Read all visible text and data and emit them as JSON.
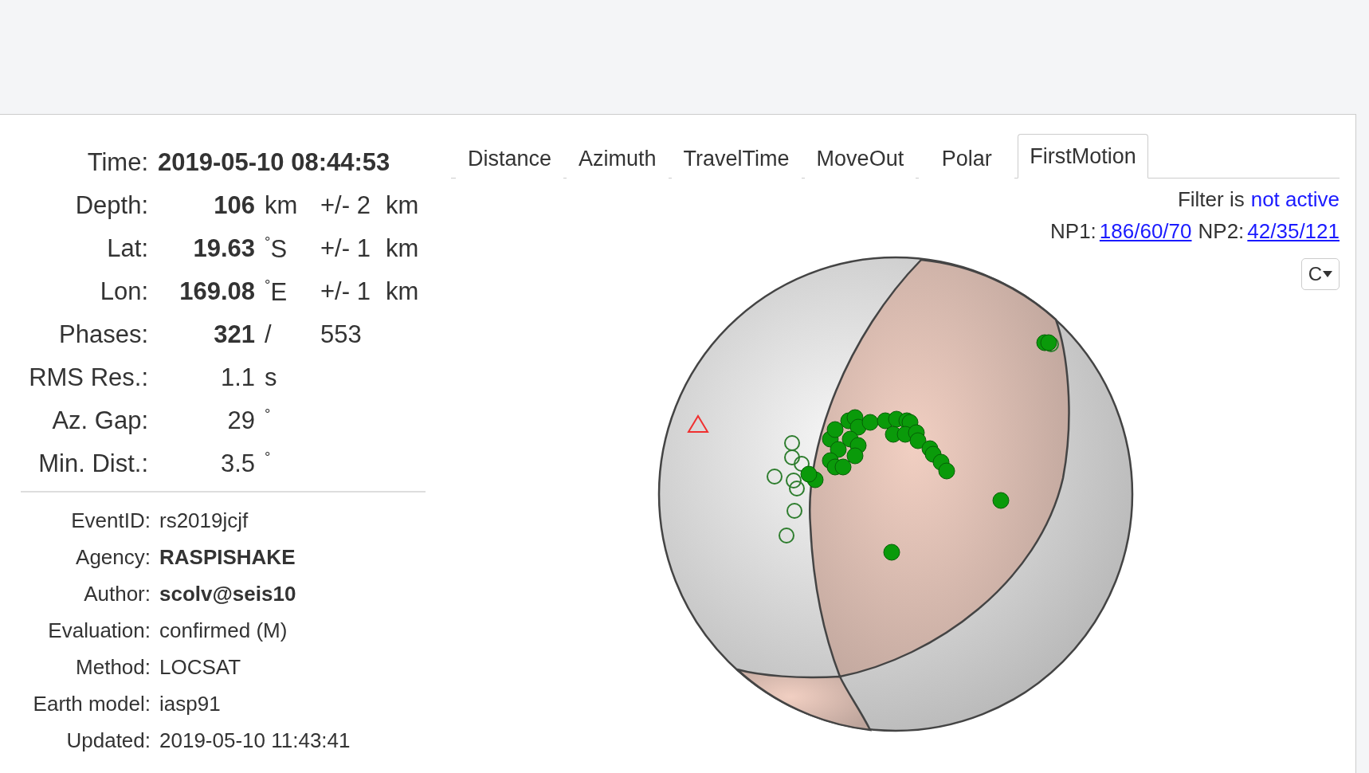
{
  "summary": [
    {
      "label": "Time:",
      "kind": "wide",
      "cells": [
        {
          "text": "2019-05-10 08:44:53",
          "bold": true
        }
      ]
    },
    {
      "label": "Depth:",
      "kind": "grid",
      "cells": [
        {
          "text": "106",
          "bold": true
        },
        {
          "text": "km",
          "bold": false
        },
        {
          "text": "+/- 2",
          "bold": false
        },
        {
          "text": "km",
          "bold": false
        }
      ]
    },
    {
      "label": "Lat:",
      "kind": "grid",
      "cells": [
        {
          "text": "19.63",
          "bold": true
        },
        {
          "text": "$^{°}$S",
          "bold": false
        },
        {
          "text": "+/- 1",
          "bold": false
        },
        {
          "text": "km",
          "bold": false
        }
      ]
    },
    {
      "label": "Lon:",
      "kind": "grid",
      "cells": [
        {
          "text": "169.08",
          "bold": true
        },
        {
          "text": "$^{°}$E",
          "bold": false
        },
        {
          "text": "+/- 1",
          "bold": false
        },
        {
          "text": "km",
          "bold": false
        }
      ]
    },
    {
      "label": "Phases:",
      "kind": "grid",
      "cells": [
        {
          "text": "321",
          "bold": true
        },
        {
          "text": "/",
          "bold": false
        },
        {
          "text": "553",
          "bold": false
        }
      ]
    },
    {
      "label": "RMS Res.:",
      "kind": "grid",
      "cells": [
        {
          "text": "1.1",
          "bold": false
        },
        {
          "text": "s",
          "bold": false
        }
      ]
    },
    {
      "label": "Az. Gap:",
      "kind": "grid",
      "cells": [
        {
          "text": "29",
          "bold": false
        },
        {
          "text": "$^{°}$",
          "bold": false
        }
      ]
    },
    {
      "label": "Min. Dist.:",
      "kind": "grid",
      "cells": [
        {
          "text": "3.5",
          "bold": false
        },
        {
          "text": "$^{°}$",
          "bold": false
        }
      ]
    }
  ],
  "details": [
    {
      "label": "EventID:",
      "value": "rs2019jcjf",
      "bold": false
    },
    {
      "label": "Agency:",
      "value": "RASPISHAKE",
      "bold": true
    },
    {
      "label": "Author:",
      "value": "scolv@seis10",
      "bold": true
    },
    {
      "label": "Evaluation:",
      "value": "confirmed (M)",
      "bold": false
    },
    {
      "label": "Method:",
      "value": "LOCSAT",
      "bold": false
    },
    {
      "label": "Earth model:",
      "value": "iasp91",
      "bold": false
    },
    {
      "label": "Updated:",
      "value": "2019-05-10 11:43:41",
      "bold": false
    }
  ],
  "tabs": [
    {
      "label": "Distance",
      "selected": false
    },
    {
      "label": "Azimuth",
      "selected": false
    },
    {
      "label": "TravelTime",
      "selected": false
    },
    {
      "label": "MoveOut",
      "selected": false
    },
    {
      "label": "Polar",
      "selected": false
    },
    {
      "label": "FirstMotion",
      "selected": true
    }
  ],
  "filter": {
    "label": "Filter is",
    "status": "not active"
  },
  "nodal_planes": [
    {
      "label": "NP1:",
      "value": "186/60/70"
    },
    {
      "label": "NP2:",
      "value": "42/35/121"
    }
  ],
  "menu_button": {
    "label": "C"
  }
}
